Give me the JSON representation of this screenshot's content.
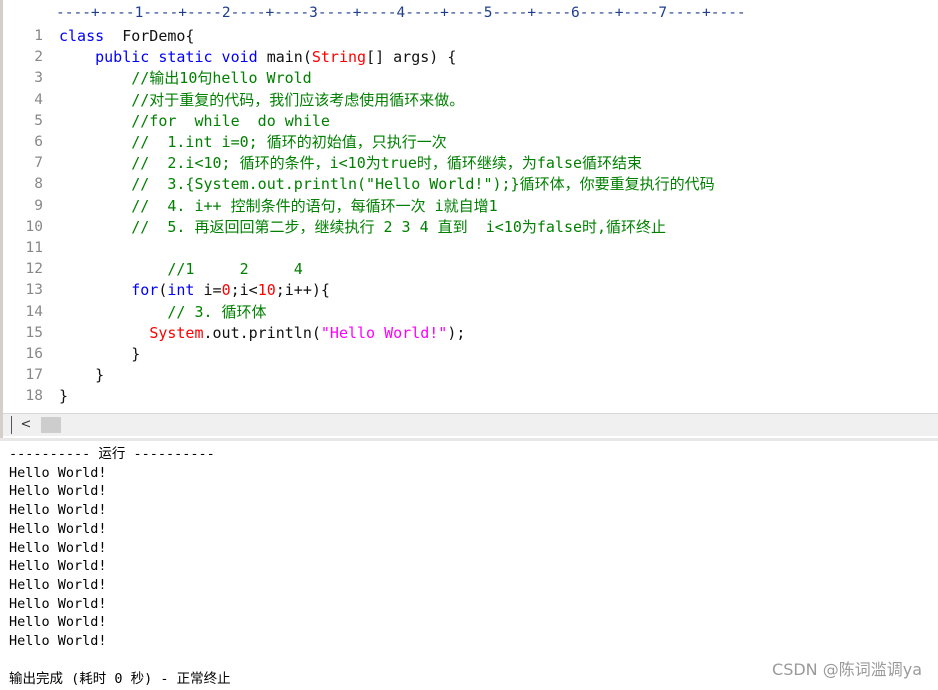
{
  "ruler": {
    "text": "----+----1----+----2----+----3----+----4----+----5----+----6----+----7----+----"
  },
  "editor": {
    "line_numbers": [
      "1",
      "2",
      "3",
      "4",
      "5",
      "6",
      "7",
      "8",
      "9",
      "10",
      "11",
      "12",
      "13",
      "14",
      "15",
      "16",
      "17",
      "18"
    ],
    "lines": [
      [
        {
          "t": "class",
          "c": "kw"
        },
        {
          "t": "  ForDemo{",
          "c": ""
        }
      ],
      [
        {
          "t": "    ",
          "c": ""
        },
        {
          "t": "public static void",
          "c": "kw"
        },
        {
          "t": " main(",
          "c": ""
        },
        {
          "t": "String",
          "c": "ty"
        },
        {
          "t": "[] args) {",
          "c": ""
        }
      ],
      [
        {
          "t": "        //输出10句hello Wrold",
          "c": "cm"
        }
      ],
      [
        {
          "t": "        //对于重复的代码，我们应该考虑使用循环来做。",
          "c": "cm"
        }
      ],
      [
        {
          "t": "        //for  while  do while",
          "c": "cm"
        }
      ],
      [
        {
          "t": "        //  1.int i=0; 循环的初始值，只执行一次",
          "c": "cm"
        }
      ],
      [
        {
          "t": "        //  2.i<10; 循环的条件，i<10为true时，循环继续，为false循环结束",
          "c": "cm"
        }
      ],
      [
        {
          "t": "        //  3.{System.out.println(\"Hello World!\");}循环体，你要重复执行的代码",
          "c": "cm"
        }
      ],
      [
        {
          "t": "        //  4. i++ 控制条件的语句，每循环一次 i就自增1",
          "c": "cm"
        }
      ],
      [
        {
          "t": "        //  5. 再返回回第二步，继续执行 2 3 4 直到  i<10为false时,循环终止",
          "c": "cm"
        }
      ],
      [
        {
          "t": "",
          "c": ""
        }
      ],
      [
        {
          "t": "            //1     2     4",
          "c": "cm"
        }
      ],
      [
        {
          "t": "        ",
          "c": ""
        },
        {
          "t": "for",
          "c": "kw"
        },
        {
          "t": "(",
          "c": ""
        },
        {
          "t": "int",
          "c": "kw"
        },
        {
          "t": " i=",
          "c": ""
        },
        {
          "t": "0",
          "c": "nm"
        },
        {
          "t": ";i<",
          "c": ""
        },
        {
          "t": "10",
          "c": "nm"
        },
        {
          "t": ";i++){",
          "c": ""
        }
      ],
      [
        {
          "t": "            // 3. 循环体",
          "c": "cm"
        }
      ],
      [
        {
          "t": "          ",
          "c": ""
        },
        {
          "t": "System",
          "c": "ty"
        },
        {
          "t": ".out.println(",
          "c": ""
        },
        {
          "t": "\"Hello World!\"",
          "c": "st"
        },
        {
          "t": ");",
          "c": ""
        }
      ],
      [
        {
          "t": "        }",
          "c": ""
        }
      ],
      [
        {
          "t": "    }",
          "c": ""
        }
      ],
      [
        {
          "t": "}",
          "c": ""
        }
      ]
    ]
  },
  "hscroll": {
    "left_arrow": "<"
  },
  "output": {
    "header": "---------- 运行 ----------",
    "lines": [
      "Hello World!",
      "Hello World!",
      "Hello World!",
      "Hello World!",
      "Hello World!",
      "Hello World!",
      "Hello World!",
      "Hello World!",
      "Hello World!",
      "Hello World!"
    ],
    "blank": "",
    "footer": "输出完成 (耗时 0 秒) - 正常终止"
  },
  "watermark": "CSDN @陈词滥调ya"
}
